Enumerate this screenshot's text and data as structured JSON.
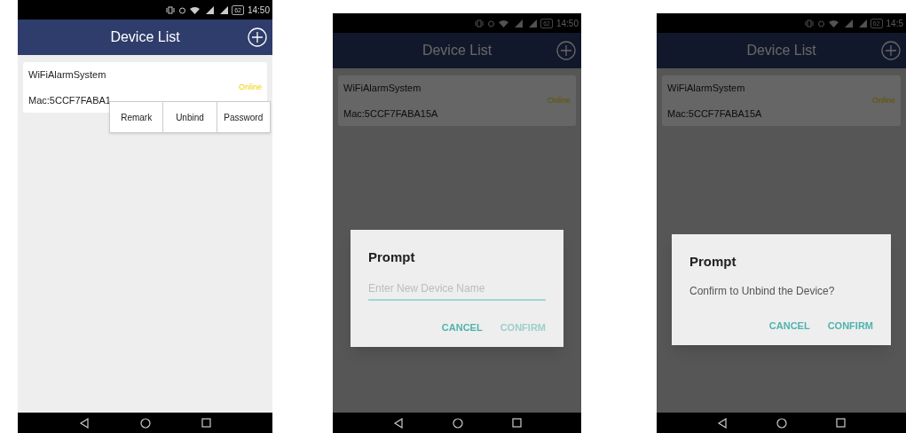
{
  "screens": [
    {
      "status_bar": {
        "battery": "62",
        "time": "14:50"
      },
      "title": "Device List",
      "device": {
        "name": "WiFiAlarmSystem",
        "mac": "Mac:5CCF7FABA1",
        "status": "Online"
      },
      "dimmed": false,
      "popup_menu": [
        "Remark",
        "Unbind",
        "Password"
      ]
    },
    {
      "status_bar": {
        "battery": "62",
        "time": "14:50"
      },
      "title": "Device List",
      "device": {
        "name": "WiFiAlarmSystem",
        "mac": "Mac:5CCF7FABA15A",
        "status": "Online"
      },
      "dimmed": true,
      "dialog": {
        "kind": "input",
        "title": "Prompt",
        "placeholder": "Enter New Device Name",
        "buttons": [
          {
            "label": "CANCEL",
            "disabled": false
          },
          {
            "label": "CONFIRM",
            "disabled": true
          }
        ]
      }
    },
    {
      "status_bar": {
        "battery": "62",
        "time": "14:5"
      },
      "title": "Device List",
      "device": {
        "name": "WiFiAlarmSystem",
        "mac": "Mac:5CCF7FABA15A",
        "status": "Online"
      },
      "dimmed": true,
      "dialog": {
        "kind": "message",
        "title": "Prompt",
        "message": "Confirm to Unbind the Device?",
        "buttons": [
          {
            "label": "CANCEL",
            "disabled": false
          },
          {
            "label": "CONFIRM",
            "disabled": false
          }
        ]
      }
    }
  ]
}
